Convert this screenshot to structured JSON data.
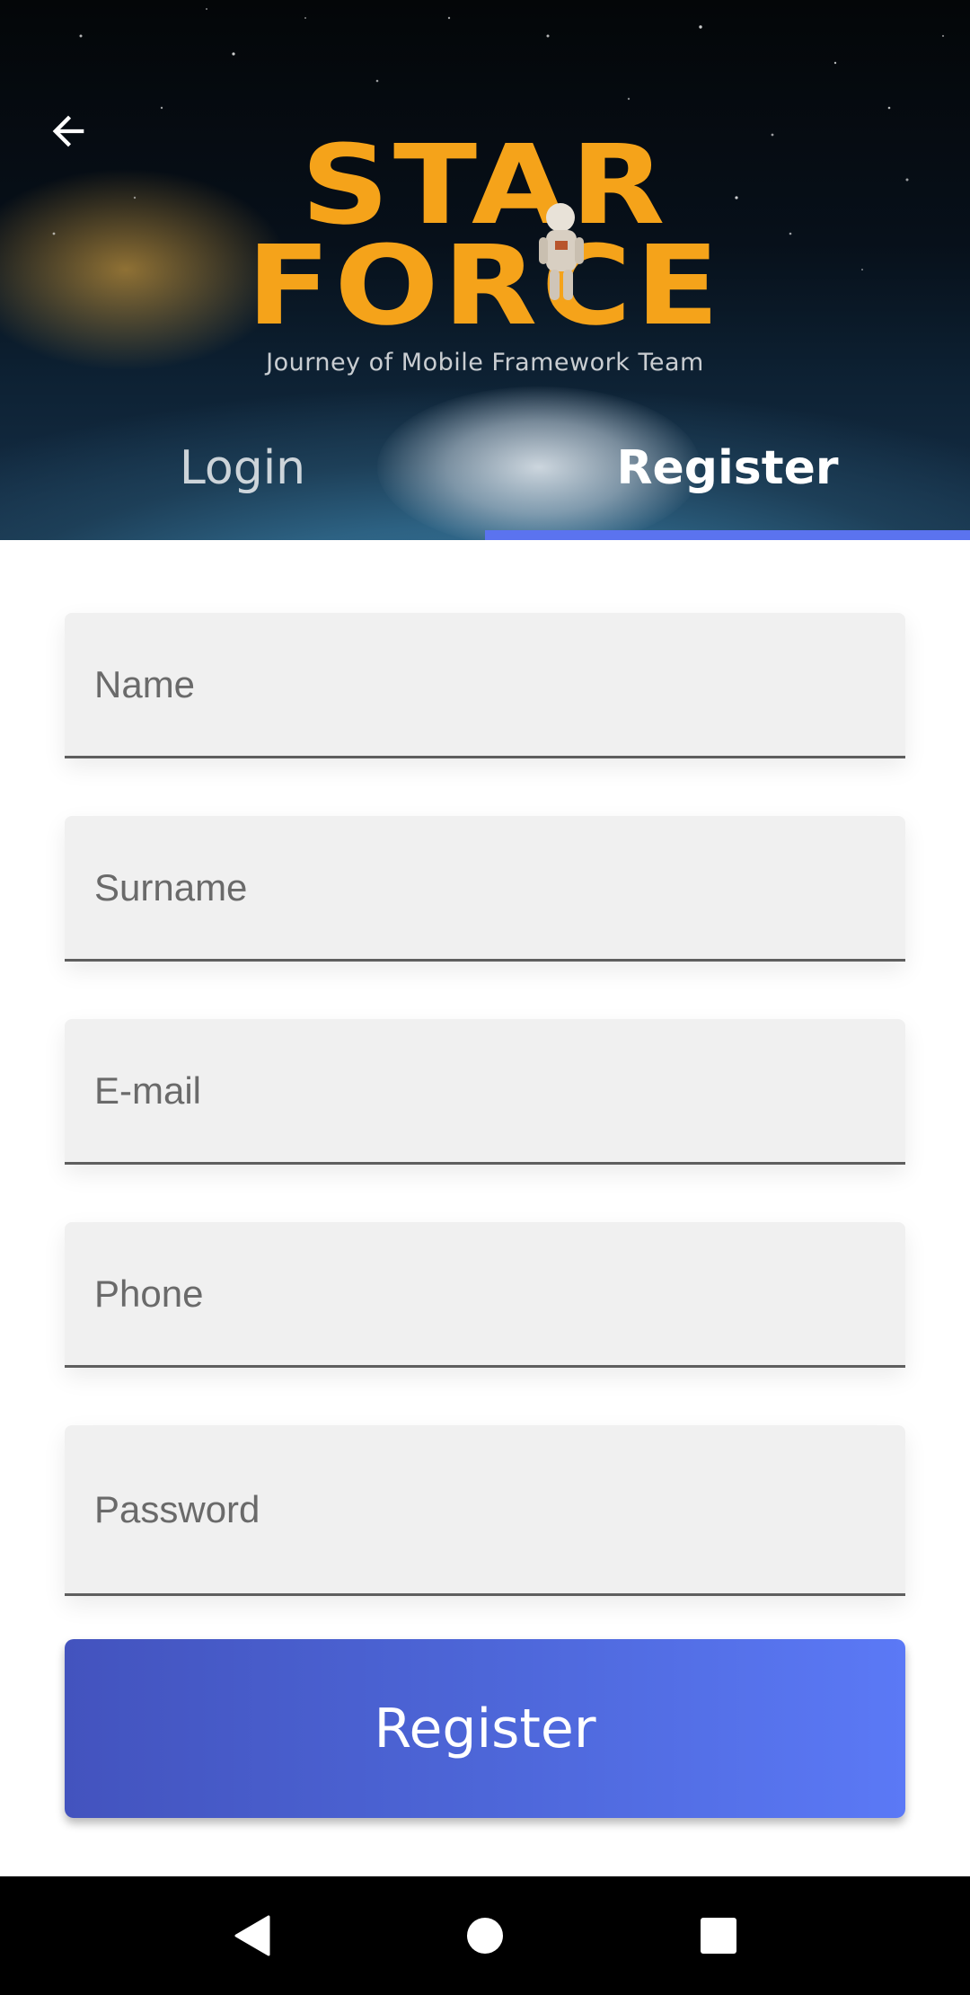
{
  "header": {
    "logo": {
      "line1": "STAR",
      "line2": "FORCE",
      "subtitle": "Journey of Mobile Framework Team",
      "color": "#f5a31a"
    },
    "back_icon": "arrow-left-icon",
    "tabs": [
      {
        "label": "Login",
        "active": false
      },
      {
        "label": "Register",
        "active": true
      }
    ],
    "indicator_color": "#5b73ef"
  },
  "form": {
    "name_placeholder": "Name",
    "surname_placeholder": "Surname",
    "email_placeholder": "E-mail",
    "phone_placeholder": "Phone",
    "password_placeholder": "Password",
    "submit_label": "Register",
    "submit_gradient": [
      "#4353be",
      "#5b79f6"
    ]
  },
  "navbar": {
    "icons": [
      "nav-back-icon",
      "nav-home-icon",
      "nav-recents-icon"
    ]
  }
}
